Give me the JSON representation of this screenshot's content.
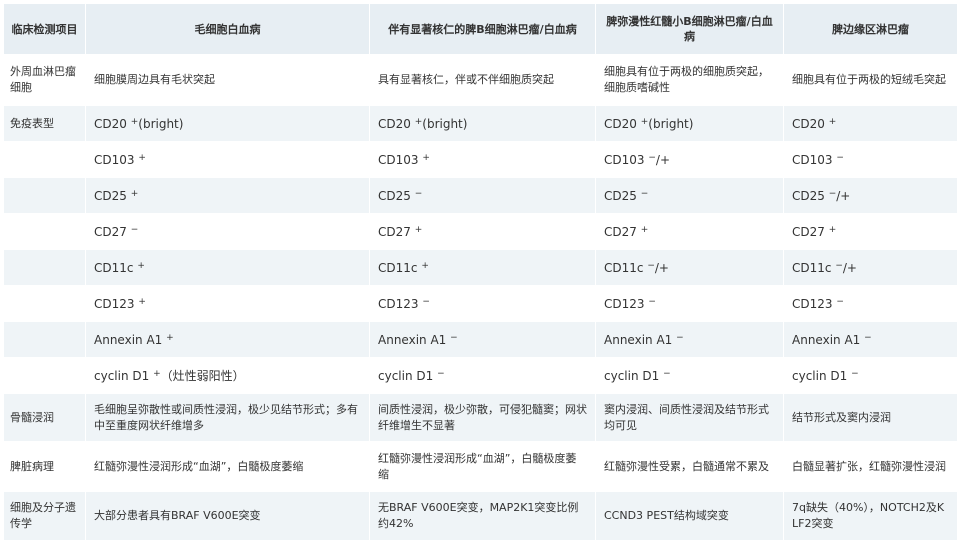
{
  "headers": [
    "临床检测项目",
    "毛细胞白血病",
    "伴有显著核仁的脾B细胞淋巴瘤/白血病",
    "脾弥漫性红髓小B细胞淋巴瘤/白血病",
    "脾边缘区淋巴瘤"
  ],
  "rows": [
    {
      "label": "外周血淋巴瘤细胞",
      "cells": [
        {
          "text": "细胞膜周边具有毛状突起"
        },
        {
          "text": "具有显著核仁，伴或不伴细胞质突起"
        },
        {
          "text": "细胞具有位于两极的细胞质突起，细胞质嗜碱性"
        },
        {
          "text": "细胞具有位于两极的短绒毛突起"
        }
      ]
    },
    {
      "label": "免疫表型",
      "cells": [
        {
          "marker": "CD20",
          "sup": "+",
          "suffix": "(bright)"
        },
        {
          "marker": "CD20",
          "sup": "+",
          "suffix": "(bright)"
        },
        {
          "marker": "CD20",
          "sup": "+",
          "suffix": "(bright)"
        },
        {
          "marker": "CD20",
          "sup": "+",
          "suffix": ""
        }
      ]
    },
    {
      "label": "",
      "cells": [
        {
          "marker": "CD103",
          "sup": "+",
          "suffix": ""
        },
        {
          "marker": "CD103",
          "sup": "+",
          "suffix": ""
        },
        {
          "marker": "CD103",
          "sup": "−",
          "suffix": "/+"
        },
        {
          "marker": "CD103",
          "sup": "−",
          "suffix": ""
        }
      ]
    },
    {
      "label": "",
      "cells": [
        {
          "marker": "CD25",
          "sup": "+",
          "suffix": ""
        },
        {
          "marker": "CD25",
          "sup": "−",
          "suffix": ""
        },
        {
          "marker": "CD25",
          "sup": "−",
          "suffix": ""
        },
        {
          "marker": "CD25",
          "sup": "−",
          "suffix": "/+"
        }
      ]
    },
    {
      "label": "",
      "cells": [
        {
          "marker": "CD27",
          "sup": "−",
          "suffix": ""
        },
        {
          "marker": "CD27",
          "sup": "+",
          "suffix": ""
        },
        {
          "marker": "CD27",
          "sup": "+",
          "suffix": ""
        },
        {
          "marker": "CD27",
          "sup": "+",
          "suffix": ""
        }
      ]
    },
    {
      "label": "",
      "cells": [
        {
          "marker": "CD11c",
          "sup": "+",
          "suffix": ""
        },
        {
          "marker": "CD11c",
          "sup": "+",
          "suffix": ""
        },
        {
          "marker": "CD11c",
          "sup": "−",
          "suffix": "/+"
        },
        {
          "marker": "CD11c",
          "sup": "−",
          "suffix": "/+"
        }
      ]
    },
    {
      "label": "",
      "cells": [
        {
          "marker": "CD123",
          "sup": "+",
          "suffix": ""
        },
        {
          "marker": "CD123",
          "sup": "−",
          "suffix": ""
        },
        {
          "marker": "CD123",
          "sup": "−",
          "suffix": ""
        },
        {
          "marker": "CD123",
          "sup": "−",
          "suffix": ""
        }
      ]
    },
    {
      "label": "",
      "cells": [
        {
          "marker": "Annexin A1",
          "sup": "+",
          "suffix": ""
        },
        {
          "marker": "Annexin A1",
          "sup": "−",
          "suffix": ""
        },
        {
          "marker": "Annexin A1",
          "sup": "−",
          "suffix": ""
        },
        {
          "marker": "Annexin A1",
          "sup": "−",
          "suffix": ""
        }
      ]
    },
    {
      "label": "",
      "cells": [
        {
          "marker": "cyclin D1",
          "sup": "+",
          "suffix": "（灶性弱阳性）"
        },
        {
          "marker": "cyclin D1",
          "sup": "−",
          "suffix": ""
        },
        {
          "marker": "cyclin D1",
          "sup": "−",
          "suffix": ""
        },
        {
          "marker": "cyclin D1",
          "sup": "−",
          "suffix": ""
        }
      ]
    },
    {
      "label": "骨髓浸润",
      "cells": [
        {
          "text": "毛细胞呈弥散性或间质性浸润，极少见结节形式；多有中至重度网状纤维增多"
        },
        {
          "text": "间质性浸润，极少弥散，可侵犯髓窦；网状纤维增生不显著"
        },
        {
          "text": "窦内浸润、间质性浸润及结节形式均可见"
        },
        {
          "text": "结节形式及窦内浸润"
        }
      ]
    },
    {
      "label": "脾脏病理",
      "cells": [
        {
          "text": "红髓弥漫性浸润形成“血湖”，白髓极度萎缩"
        },
        {
          "text": "红髓弥漫性浸润形成“血湖”，白髓极度萎缩"
        },
        {
          "text": "红髓弥漫性受累，白髓通常不累及"
        },
        {
          "text": "白髓显著扩张，红髓弥漫性浸润"
        }
      ]
    },
    {
      "label": "细胞及分子遗传学",
      "cells": [
        {
          "text": "大部分患者具有BRAF V600E突变"
        },
        {
          "text": "无BRAF V600E突变，MAP2K1突变比例约42%"
        },
        {
          "text": "CCND3 PEST结构域突变"
        },
        {
          "text": "7q缺失（40%），NOTCH2及KLF2突变"
        }
      ]
    }
  ]
}
